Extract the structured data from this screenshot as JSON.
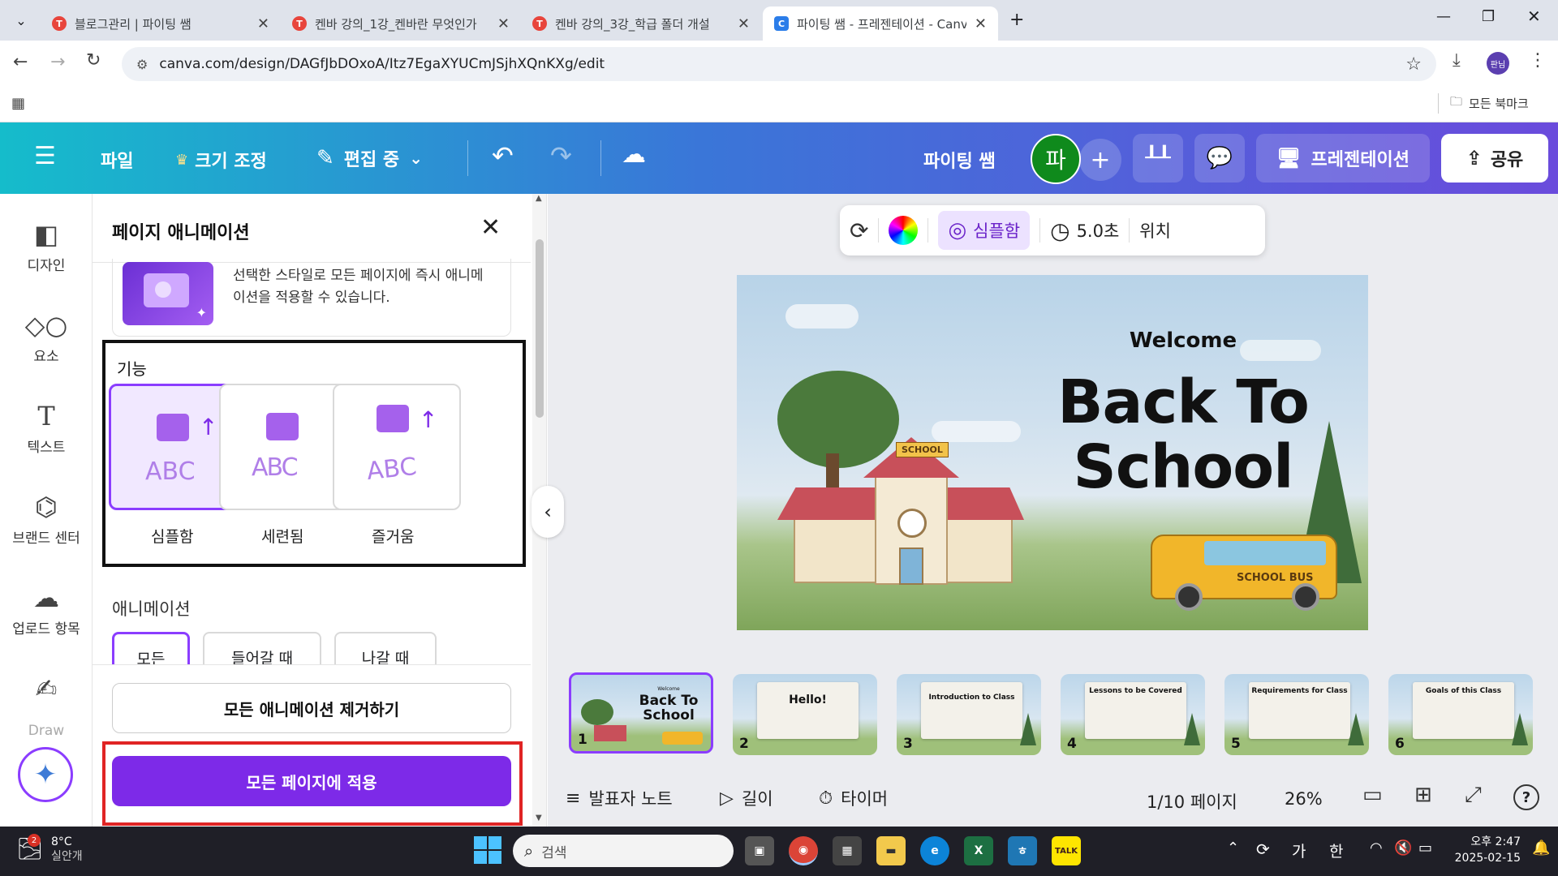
{
  "browser": {
    "tabs": [
      {
        "title": "블로그관리 | 파이팅 쌤",
        "active": false
      },
      {
        "title": "켄바 강의_1강_켄바란 무엇인가",
        "active": false
      },
      {
        "title": "켄바 강의_3강_학급 폴더 개설",
        "active": false
      },
      {
        "title": "파이팅 쌤 - 프레젠테이션 - Canva",
        "active": true
      }
    ],
    "url": "canva.com/design/DAGfJbDOxoA/Itz7EgaXYUCmJSjhXQnKXg/edit",
    "profile_badge": "판님",
    "bookmarks_label": "모든 북마크"
  },
  "header": {
    "file": "파일",
    "resize": "크기 조정",
    "editing": "편집 중",
    "project_name": "파이팅 쌤",
    "avatar_initial": "파",
    "present": "프레젠테이션",
    "share": "공유",
    "avatar_color": "#0f8a1c"
  },
  "rail": {
    "items": [
      "디자인",
      "요소",
      "텍스트",
      "브랜드 센터",
      "업로드 항목",
      "Draw"
    ]
  },
  "panel": {
    "title": "페이지 애니메이션",
    "intro": "선택한 스타일로 모든 페이지에 즉시 애니메이션을 적용할 수 있습니다.",
    "features_label": "기능",
    "features": [
      "심플함",
      "세련됨",
      "즐거움"
    ],
    "preview_text": "ABC",
    "animation_label": "애니메이션",
    "animation_tabs": [
      "모든",
      "들어갈 때",
      "나갈 때"
    ],
    "remove_all": "모든 애니메이션 제거하기",
    "apply_all": "모든 페이지에 적용",
    "accent": "#7d2ae8"
  },
  "toolbar": {
    "style": "심플함",
    "duration": "5.0초",
    "position": "위치"
  },
  "slide": {
    "welcome": "Welcome",
    "title_line1": "Back To",
    "title_line2": "School",
    "school_sign": "SCHOOL",
    "bus_text": "SCHOOL BUS"
  },
  "thumbnails": [
    {
      "num": "1",
      "title": "Back To School"
    },
    {
      "num": "2",
      "title": "Hello!"
    },
    {
      "num": "3",
      "title": "Introduction to Class"
    },
    {
      "num": "4",
      "title": "Lessons to be Covered"
    },
    {
      "num": "5",
      "title": "Requirements for Class"
    },
    {
      "num": "6",
      "title": "Goals of this Class"
    }
  ],
  "footer": {
    "notes": "발표자 노트",
    "duration": "길이",
    "timer": "타이머",
    "page": "1/10 페이지",
    "zoom": "26%"
  },
  "taskbar": {
    "weather_temp": "8°C",
    "weather_desc": "실안개",
    "weather_badge": "2",
    "search": "검색",
    "ime_lang1": "가",
    "ime_lang2": "한",
    "time": "오후 2:47",
    "date": "2025-02-15"
  }
}
